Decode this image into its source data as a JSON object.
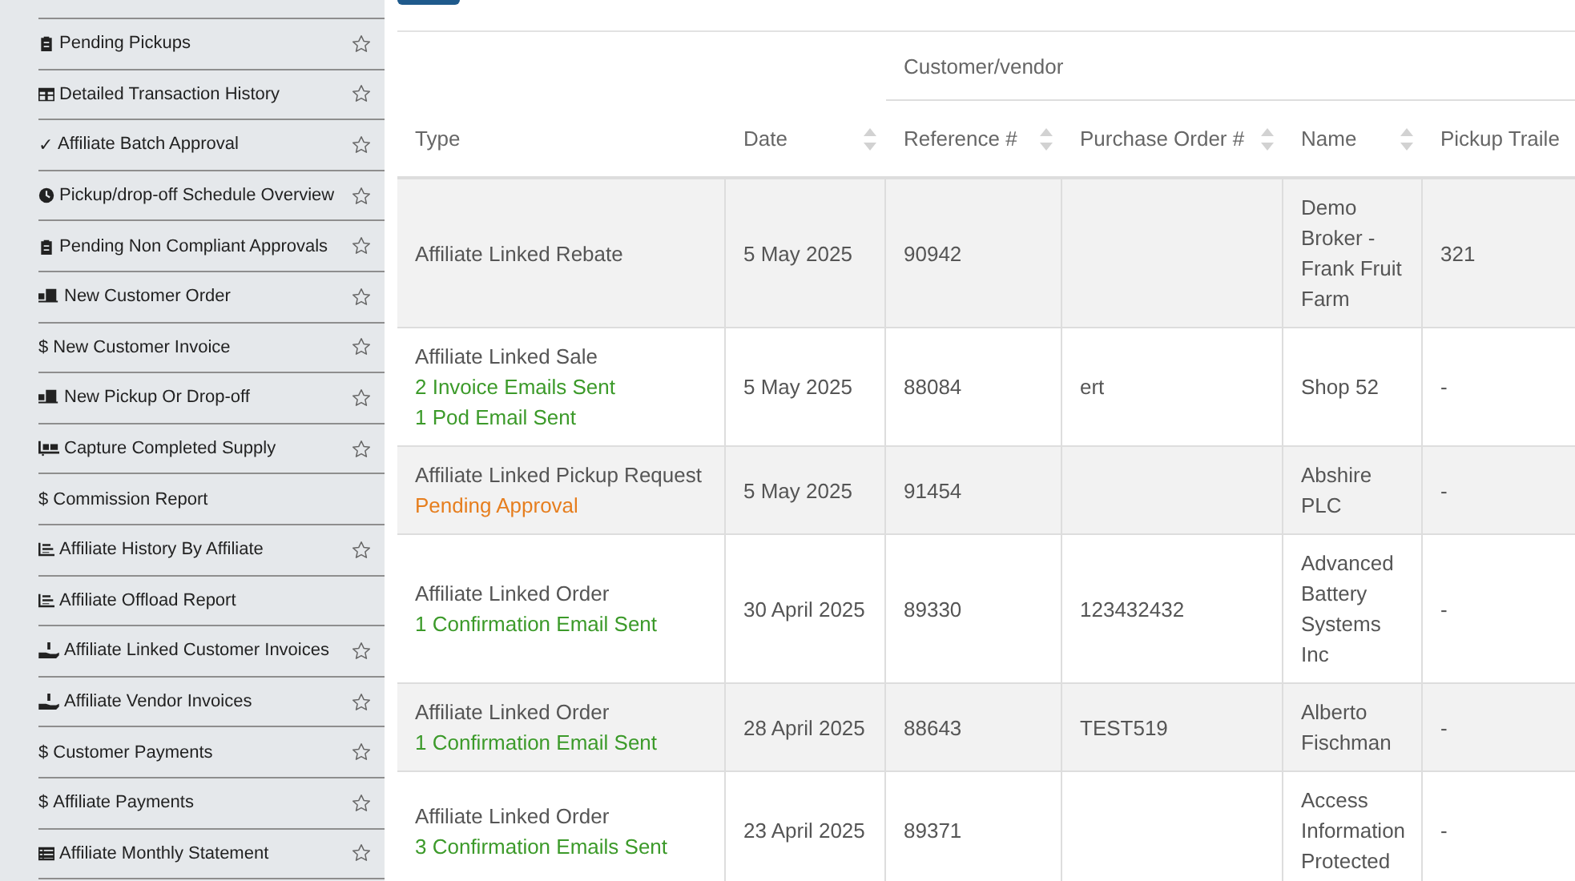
{
  "sidebar": {
    "items": [
      {
        "kind": "clipboard",
        "label": "Pending Pickups",
        "has_star": true
      },
      {
        "kind": "table",
        "label": "Detailed Transaction History",
        "has_star": true
      },
      {
        "kind": "glyph",
        "glyph": "✓",
        "label": "Affiliate Batch Approval",
        "has_star": true
      },
      {
        "kind": "clock",
        "label": "Pickup/drop-off Schedule Overview",
        "has_star": true
      },
      {
        "kind": "clipboard",
        "label": "Pending Non Compliant Approvals",
        "has_star": true
      },
      {
        "kind": "truck",
        "label": "New Customer Order",
        "has_star": true
      },
      {
        "kind": "glyph",
        "glyph": "$",
        "label": "New Customer Invoice",
        "has_star": true
      },
      {
        "kind": "truck",
        "label": "New Pickup Or Drop-off",
        "has_star": true
      },
      {
        "kind": "cart",
        "label": "Capture Completed Supply",
        "has_star": true
      },
      {
        "kind": "glyph",
        "glyph": "$",
        "label": "Commission Report",
        "has_star": false
      },
      {
        "kind": "chart",
        "label": "Affiliate History By Affiliate",
        "has_star": true
      },
      {
        "kind": "chart",
        "label": "Affiliate Offload Report",
        "has_star": false
      },
      {
        "kind": "hand",
        "label": "Affiliate Linked Customer Invoices",
        "has_star": true
      },
      {
        "kind": "hand",
        "label": "Affiliate Vendor Invoices",
        "has_star": true
      },
      {
        "kind": "glyph",
        "glyph": "$",
        "label": "Customer Payments",
        "has_star": true
      },
      {
        "kind": "glyph",
        "glyph": "$",
        "label": "Affiliate Payments",
        "has_star": true
      },
      {
        "kind": "list",
        "label": "Affiliate Monthly Statement",
        "has_star": true
      }
    ]
  },
  "table": {
    "group_header": "Customer/vendor",
    "columns": [
      {
        "label": "Type",
        "sortable": false
      },
      {
        "label": "Date",
        "sortable": true
      },
      {
        "label": "Reference #",
        "sortable": true
      },
      {
        "label": "Purchase Order #",
        "sortable": true
      },
      {
        "label": "Name",
        "sortable": true
      },
      {
        "label": "Pickup Traile",
        "sortable": false
      }
    ],
    "rows": [
      {
        "type": "Affiliate Linked Rebate",
        "statuses": [],
        "date": "5 May 2025",
        "reference": "90942",
        "purchase_order": "",
        "name": [
          "Demo",
          "Broker -",
          "Frank Fruit",
          "Farm"
        ],
        "pickup_trailer": "321"
      },
      {
        "type": "Affiliate Linked Sale",
        "statuses": [
          {
            "text": "2 Invoice Emails Sent",
            "color": "#3c9a2a"
          },
          {
            "text": "1 Pod Email Sent",
            "color": "#3c9a2a"
          }
        ],
        "date": "5 May 2025",
        "reference": "88084",
        "purchase_order": "ert",
        "name": [
          "Shop 52"
        ],
        "pickup_trailer": "-"
      },
      {
        "type": "Affiliate Linked Pickup Request",
        "statuses": [
          {
            "text": "Pending Approval",
            "color": "#e67e1e"
          }
        ],
        "date": "5 May 2025",
        "reference": "91454",
        "purchase_order": "",
        "name": [
          "Abshire",
          "PLC"
        ],
        "pickup_trailer": "-"
      },
      {
        "type": "Affiliate Linked Order",
        "statuses": [
          {
            "text": "1 Confirmation Email Sent",
            "color": "#3c9a2a"
          }
        ],
        "date": "30 April 2025",
        "reference": "89330",
        "purchase_order": "123432432",
        "name": [
          "Advanced",
          "Battery",
          "Systems",
          "Inc"
        ],
        "pickup_trailer": "-"
      },
      {
        "type": "Affiliate Linked Order",
        "statuses": [
          {
            "text": "1 Confirmation Email Sent",
            "color": "#3c9a2a"
          }
        ],
        "date": "28 April 2025",
        "reference": "88643",
        "purchase_order": "TEST519",
        "name": [
          "Alberto",
          "Fischman"
        ],
        "pickup_trailer": "-"
      },
      {
        "type": "Affiliate Linked Order",
        "statuses": [
          {
            "text": "3 Confirmation Emails Sent",
            "color": "#3c9a2a"
          }
        ],
        "date": "23 April 2025",
        "reference": "89371",
        "purchase_order": "",
        "name": [
          "Access",
          "Information",
          "Protected"
        ],
        "pickup_trailer": "-"
      }
    ]
  }
}
